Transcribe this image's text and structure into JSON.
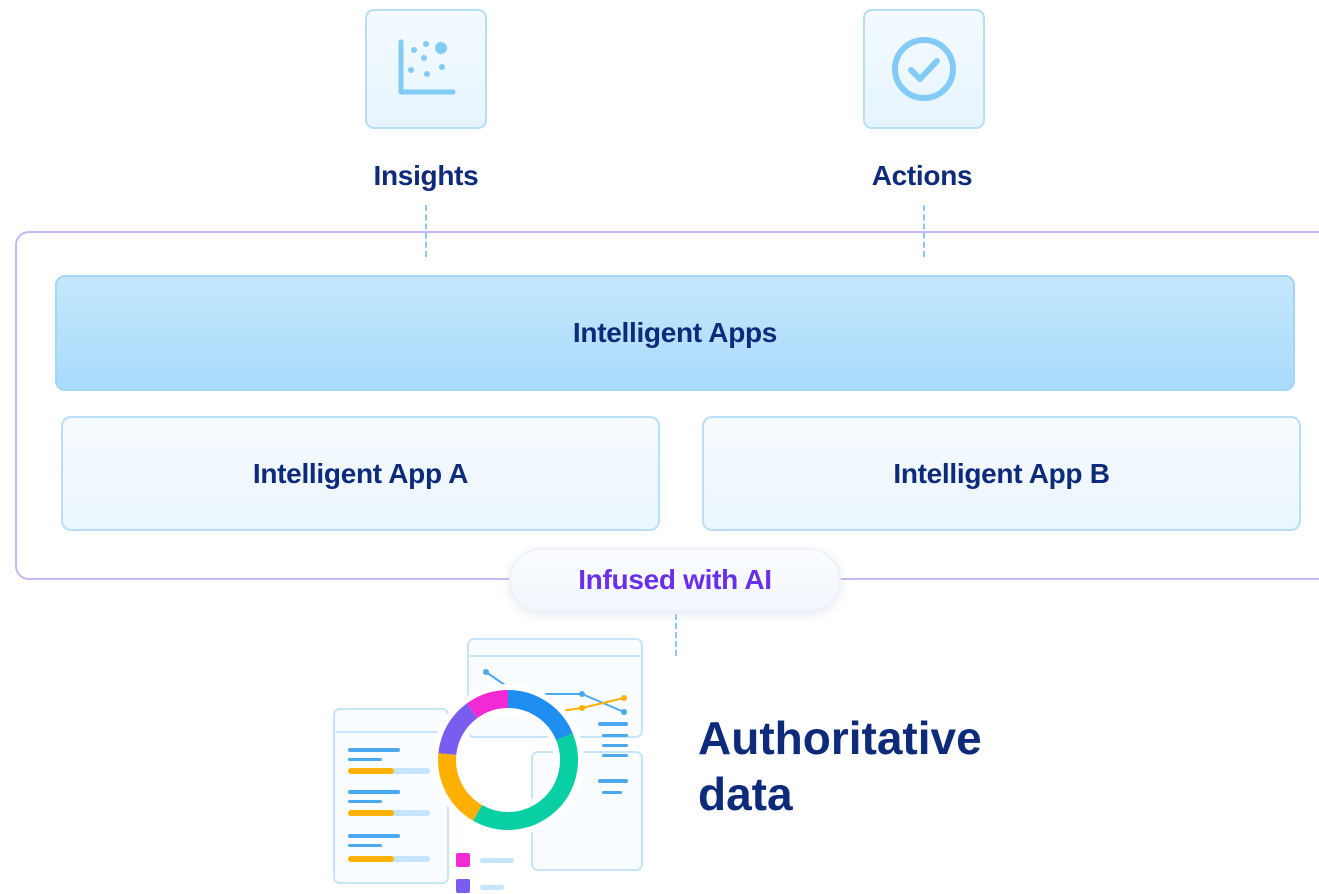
{
  "top_items": [
    {
      "label": "Insights",
      "icon": "scatter-chart-icon"
    },
    {
      "label": "Actions",
      "icon": "check-circle-icon"
    }
  ],
  "apps_layer": {
    "title": "Intelligent Apps",
    "apps": [
      "Intelligent App A",
      "Intelligent App B"
    ]
  },
  "ai_badge": "Infused with AI",
  "data_layer": {
    "line1": "Authoritative",
    "line2": "data",
    "illustration": "dashboard-data-illustration"
  },
  "colors": {
    "navy": "#0d2b7a",
    "purple": "#6a2fe8",
    "light_blue": "#a9dbfb",
    "donut": [
      "#1e8ef0",
      "#08cfa4",
      "#ffb000",
      "#7b5cf0",
      "#f22ad4"
    ]
  }
}
